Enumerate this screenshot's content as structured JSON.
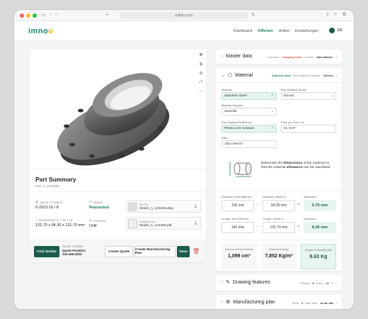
{
  "browser": {
    "url": "tibby.com"
  },
  "nav": {
    "logo_main": "imno",
    "logo_accent": "o",
    "links": [
      "Dashboard",
      "Offerten",
      "Artikel",
      "Einstellungen"
    ],
    "active_index": 1,
    "language": "DE"
  },
  "summary": {
    "title": "Part Summary",
    "subtitle": "Part: A_1234569",
    "quote_position_label": "Quote / Position",
    "quote_position_value": "0-2023-16 / 8",
    "status_label": "Status",
    "status_value": "Requested",
    "dimensions_label": "Dimensions (L x W x H)",
    "dimensions_value": "131.70 x 94.30 x 131.70 mm",
    "currency_label": "Currency",
    "currency_value": "CHF",
    "file1_label": "3D File",
    "file1_name": "Model_A_123456.step",
    "file2_label": "Drawing File",
    "file2_name": "Model_A_123456.pdf"
  },
  "actions": {
    "find_similar": "Find Similar",
    "score": "Score: 123456",
    "quote_position": "Quote Position:",
    "quote_id": "123.456.2023",
    "create_quote": "Create Quote",
    "create_run": "Create Manufacturing Run",
    "save": "Save"
  },
  "master": {
    "title": "Master data",
    "customer_label": "Customer:",
    "customer": "Company Name",
    "contact_label": "Contact:",
    "contact": "Hans Muster"
  },
  "material": {
    "title": "Material",
    "selected": "Stainless Steel",
    "diameter_meta_label": "Raw Material Diameter:",
    "diameter_meta": "100 mm",
    "material_label": "Material",
    "material_value": "Stainless Steel",
    "shape_label": "Raw Material Shape",
    "shape_value": "Round",
    "supplier_label": "Material Supplier",
    "supplier_value": "Stamsfe",
    "reference_label": "Raw Material Reference",
    "reference_value": "PEEK LGS schwarz",
    "price_label": "Price per Raw Cut",
    "price_value": "81 CHF",
    "rate_label": "Rate",
    "rate_value": "150 CHF/m³",
    "info_text_pre": "Determine the ",
    "info_dimensions": "dimensions",
    "info_text_mid": " of the material so that the material ",
    "info_allowance": "allowance",
    "info_text_post": " can be calculated",
    "diam_raw_label": "Diameter: Raw Material",
    "diam_raw_value": "100 mm",
    "diam_article_label": "Diameter: Article A",
    "diam_article_value": "94.30 mm",
    "diam_allow_label": "Allowance",
    "diam_allow_value": "6.70 mm",
    "len_raw_label": "Length: Raw Material",
    "len_raw_value": "140 mm",
    "len_article_label": "Length: Article A",
    "len_article_value": "131.70 mm",
    "len_allow_label": "Allowance",
    "len_allow_value": "8.30 mm",
    "vol_label": "Volume of Raw Material",
    "vol_value": "1,099 cm³",
    "density_label": "Material Density",
    "density_value": "7,852 Kg/m³",
    "weight_label": "Weight of Standing Bar",
    "weight_value": "8.63 Kg"
  },
  "drawing": {
    "title": "Drawing features",
    "threads_label": "Threads:",
    "threads": "5",
    "holes_label": "Holes:",
    "holes": "12"
  },
  "manufacturing": {
    "title": "Manufacturing plan",
    "steps_label": "Steps:",
    "steps": "3",
    "time_label": "Total Time:",
    "time": "2h 4m 48s"
  }
}
